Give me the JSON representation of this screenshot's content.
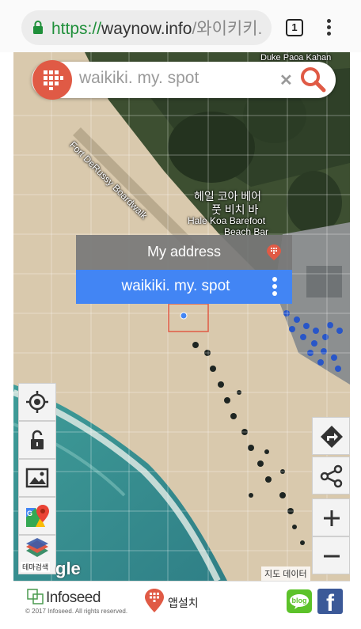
{
  "browser": {
    "url_scheme": "https://",
    "url_host": "waynow.info",
    "url_path": "/와이키키.",
    "tab_count": "1"
  },
  "search": {
    "value": "waikiki. my. spot"
  },
  "map": {
    "labels": {
      "top_right": "Duke Paoa Kahan",
      "street": "Fort DeRussy Boardwalk",
      "poi_korean_line1": "헤일 코아 베어",
      "poi_korean_line2": "풋 비치 바",
      "poi_english_line1": "Hale Koa Barefoot",
      "poi_english_line2": "Beach Bar"
    },
    "google_mark": "gle",
    "attribution": "지도 데이터"
  },
  "popup": {
    "header": "My address",
    "place": "waikiki. my. spot"
  },
  "tools": {
    "theme_search_label": "테마검색"
  },
  "footer": {
    "brand": "Infoseed",
    "copyright": "© 2017 Infoseed. All rights reserved.",
    "app_install": "앱설치",
    "blog_label": "blog",
    "facebook_label": "f"
  },
  "colors": {
    "brand_red": "#e05a45",
    "accent_blue": "#4285f4",
    "url_green": "#1f8f3a"
  }
}
